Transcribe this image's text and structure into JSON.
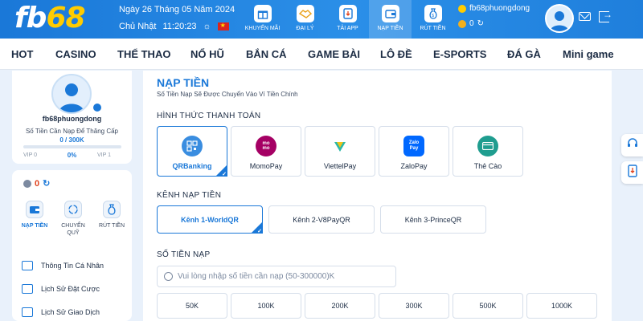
{
  "header": {
    "logo_fb": "fb",
    "logo_num": "68",
    "date": "Ngày 26 Tháng 05 Năm 2024",
    "weekday": "Chủ Nhật",
    "time": "11:20:23",
    "nav": [
      {
        "label": "KHUYẾN MÃI",
        "icon": "gift-icon"
      },
      {
        "label": "ĐẠI LÝ",
        "icon": "handshake-icon"
      },
      {
        "label": "TẢI APP",
        "icon": "download-app-icon"
      },
      {
        "label": "NẠP TIỀN",
        "icon": "wallet-icon",
        "active": true
      },
      {
        "label": "RÚT TIỀN",
        "icon": "money-bag-icon"
      }
    ],
    "username": "fb68phuongdong",
    "balance": "0"
  },
  "mainnav": {
    "items": [
      "HOT",
      "CASINO",
      "THỂ THAO",
      "NỔ HŨ",
      "BẮN CÁ",
      "GAME BÀI",
      "LÔ ĐỀ",
      "E-SPORTS",
      "ĐÁ GÀ",
      "Mini game"
    ]
  },
  "profile": {
    "username": "fb68phuongdong",
    "note": "Số Tiền Cần Nạp Để Thăng Cấp",
    "progress_text": "0  /  300K",
    "progress_fraction": 0,
    "vip_current": "VIP 0",
    "percent": "0%",
    "vip_next": "VIP 1"
  },
  "wallet": {
    "balance": "0",
    "actions": [
      {
        "label": "NẠP TIỀN",
        "active": true
      },
      {
        "label": "CHUYỂN QUỸ",
        "active": false
      },
      {
        "label": "RÚT TIỀN",
        "active": false
      }
    ],
    "menu": [
      "Thông Tin Cá Nhân",
      "Lịch Sử Đặt Cược",
      "Lịch Sử Giao Dịch"
    ]
  },
  "deposit": {
    "title": "NẠP TIỀN",
    "subtitle": "Số Tiền Nạp Sẽ Được Chuyển Vào Ví Tiền Chính",
    "method_heading": "HÌNH THỨC THANH TOÁN",
    "methods": [
      {
        "label": "QRBanking",
        "active": true,
        "icon_color": "#3a8de0"
      },
      {
        "label": "MomoPay",
        "active": false,
        "icon_color": "#a50064"
      },
      {
        "label": "ViettelPay",
        "active": false,
        "icon_color": "#2cb8a8"
      },
      {
        "label": "ZaloPay",
        "active": false,
        "icon_color": "#0068ff"
      },
      {
        "label": "Thẻ Cào",
        "active": false,
        "icon_color": "#1f9d8f"
      }
    ],
    "channel_heading": "KÊNH NẠP TIỀN",
    "channels": [
      {
        "label": "Kênh 1-WorldQR",
        "active": true
      },
      {
        "label": "Kênh 2-V8PayQR",
        "active": false
      },
      {
        "label": "Kênh 3-PrinceQR",
        "active": false
      }
    ],
    "amount_heading": "SỐ TIỀN NẠP",
    "amount_placeholder": "Vui lòng nhập số tiền cần nạp (50-300000)K",
    "amounts": [
      "50K",
      "100K",
      "200K",
      "300K",
      "500K",
      "1000K"
    ],
    "momo_text": "mo\nmo",
    "zalo_text": "Zalo Pay"
  },
  "colors": {
    "primary": "#1a78d8",
    "accent": "#ffcc00",
    "balance_red": "#e0431e"
  }
}
